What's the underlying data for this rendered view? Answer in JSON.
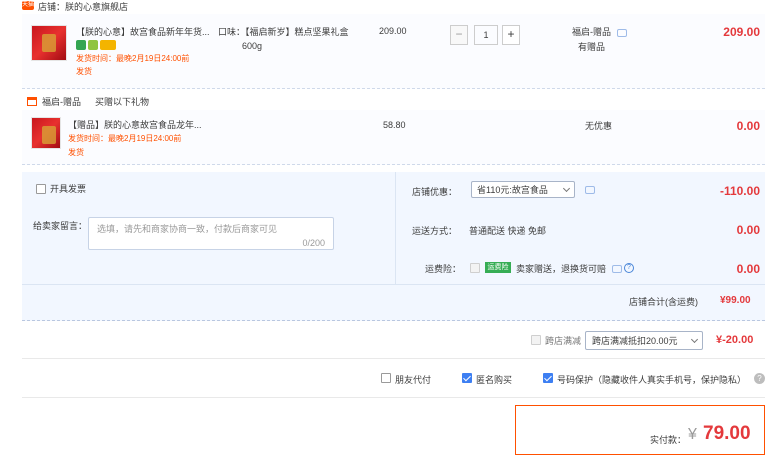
{
  "shop": {
    "badge": "天猫",
    "label": "店铺：朕的心意旗舰店"
  },
  "items": [
    {
      "title": "【朕的心意】故宫食品新年年货...",
      "ship_time": "发货时间：最晚2月19日24:00前",
      "ship_label": "发货",
      "spec_label": "口味：【福启新岁】糕点坚果礼盒",
      "spec_weight": "600g",
      "price": "209.00",
      "quantity": "1",
      "discount": "福启-赠品",
      "discount_sub": "有赠品",
      "total": "209.00"
    }
  ],
  "gift_section": {
    "header": "福启-赠品",
    "header_sub": "买赠以下礼物",
    "title": "【赠品】朕的心意故宫食品龙年...",
    "ship_time": "发货时间：最晚2月19日24:00前",
    "ship_label": "发货",
    "price": "58.80",
    "discount": "无优惠",
    "total": "0.00"
  },
  "summary": {
    "invoice_label": "开具发票",
    "message_label": "给卖家留言：",
    "message_placeholder": "选填，请先和商家协商一致，付款后商家可见",
    "message_count": "0/200",
    "shop_discount_label": "店铺优惠：",
    "shop_discount_value": "省110元:故宫食品",
    "shop_discount_amount": "-110.00",
    "delivery_label": "运送方式：",
    "delivery_value": "普通配送 快递 免邮",
    "delivery_amount": "0.00",
    "insurance_label": "运费险：",
    "insurance_badge": "运费险",
    "insurance_value": "卖家赠送，退换货可赔",
    "insurance_amount": "0.00",
    "shop_total_label": "店铺合计(含运费)",
    "shop_total_value": "¥99.00"
  },
  "cross_store": {
    "label": "跨店满减",
    "select_value": "跨店满减抵扣20.00元",
    "amount": "¥-20.00"
  },
  "options": {
    "friend_pay": "朋友代付",
    "anonymous": "匿名购买",
    "phone_protect": "号码保护（隐藏收件人真实手机号，保护隐私）"
  },
  "payment": {
    "label": "实付款：",
    "currency": "¥",
    "amount": "79.00"
  }
}
